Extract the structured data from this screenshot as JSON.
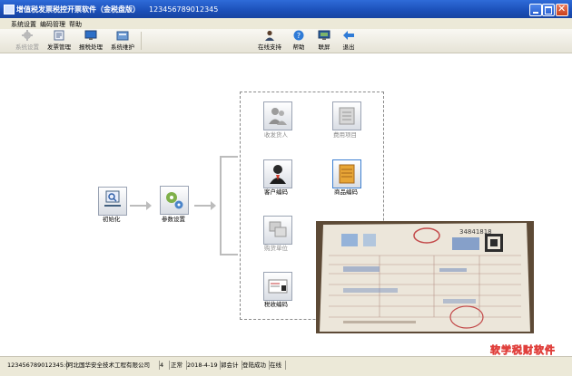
{
  "window": {
    "title": "增值税发票税控开票软件（金税盘版）",
    "serial": "123456789012345"
  },
  "menu": [
    {
      "label": "系统设置"
    },
    {
      "label": "编码管理"
    },
    {
      "label": "帮助"
    }
  ],
  "toolbar": {
    "left": [
      {
        "label": "系统设置",
        "icon": "gear-icon",
        "enabled": false
      },
      {
        "label": "发票管理",
        "icon": "invoice-icon",
        "enabled": true
      },
      {
        "label": "报税处理",
        "icon": "monitor-icon",
        "enabled": true
      },
      {
        "label": "系统维护",
        "icon": "tools-icon",
        "enabled": true
      }
    ],
    "right": [
      {
        "label": "在线支持",
        "icon": "user-support-icon"
      },
      {
        "label": "帮助",
        "icon": "help-icon"
      },
      {
        "label": "联屏",
        "icon": "screen-icon"
      },
      {
        "label": "退出",
        "icon": "exit-arrow-icon"
      }
    ]
  },
  "flow": {
    "init": {
      "label": "初始化",
      "icon": "init-icon"
    },
    "params": {
      "label": "参数设置",
      "icon": "gears-icon"
    },
    "items": [
      {
        "label": "收发货人",
        "icon": "contacts-icon",
        "enabled": false
      },
      {
        "label": "费用项目",
        "icon": "expense-items-icon",
        "enabled": false
      },
      {
        "label": "客户编码",
        "icon": "customer-icon",
        "enabled": true
      },
      {
        "label": "商品编码",
        "icon": "product-icon",
        "enabled": true
      },
      {
        "label": "购货单位",
        "icon": "purchaser-icon",
        "enabled": false
      },
      {
        "label": "税收编码",
        "icon": "tax-code-icon",
        "enabled": true
      }
    ]
  },
  "photo": {
    "invoice_no": "34841818"
  },
  "watermark": "软学税财软件",
  "status": {
    "taxpayer_id": "123456789012345:0",
    "company": "河北国华安全技术工程有限公司",
    "num": "4",
    "state": "正常",
    "date": "2018-4-19",
    "role": "郭会计",
    "login": "登陆成功",
    "online": "在线"
  }
}
